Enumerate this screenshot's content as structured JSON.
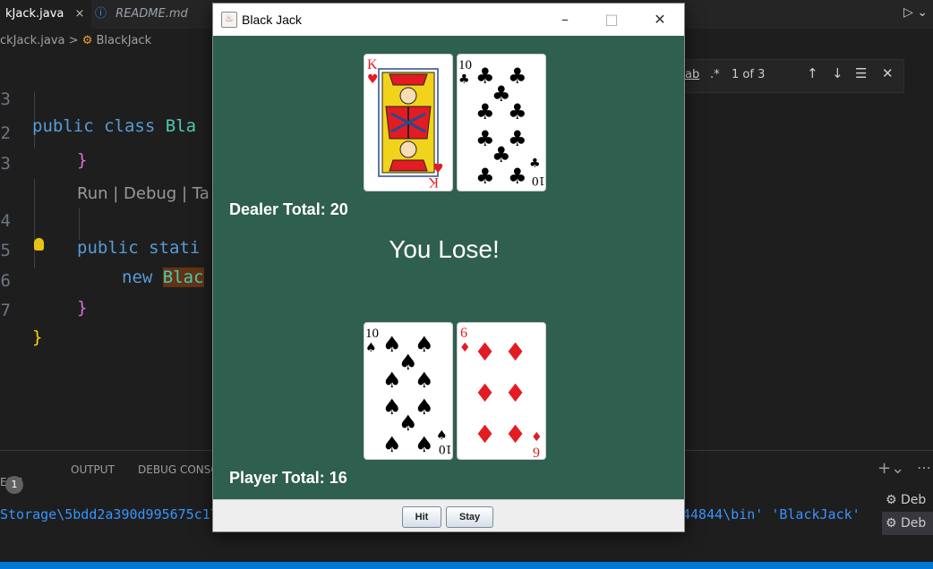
{
  "vscode": {
    "tabs": [
      {
        "label": "kJack.java",
        "close": "×"
      },
      {
        "label": "README.md",
        "icon": "info-icon"
      }
    ],
    "breadcrumb": {
      "file": "ckJack.java",
      "separator": ">",
      "symbol": "BlackJack"
    },
    "code": {
      "line_numbers": [
        "3",
        "2",
        "3",
        "4",
        "5",
        "6",
        "7"
      ],
      "l1_kw": "public class ",
      "l1_cls": "Bla",
      "l2": "}",
      "codelens": "Run | Debug | Ta",
      "l4_kw": "public stati",
      "l5_kw": "new ",
      "l5_cls": "Blac",
      "l6": "}",
      "l7": "}"
    },
    "find": {
      "ab": "ab",
      "regex": ".*",
      "count": "1 of 3"
    },
    "panel": {
      "problems": "EMS",
      "problems_count": "1",
      "output": "OUTPUT",
      "debug_console": "DEBUG CONSO",
      "terminal_left": "Storage\\5bdd2a390d995675c17",
      "terminal_right": "44844\\bin' 'BlackJack'",
      "debug_items": [
        "Deb",
        "Deb"
      ]
    }
  },
  "window": {
    "title": "Black Jack",
    "minimize": "–",
    "maximize": "□",
    "close": "✕"
  },
  "game": {
    "dealer_total": "Dealer Total: 20",
    "player_total": "Player Total: 16",
    "result": "You Lose!",
    "dealer_cards": [
      {
        "rank": "K",
        "suit": "♥",
        "color": "#e31b23"
      },
      {
        "rank": "10",
        "suit": "♣",
        "color": "#000000"
      }
    ],
    "player_cards": [
      {
        "rank": "10",
        "suit": "♠",
        "color": "#000000"
      },
      {
        "rank": "6",
        "suit": "♦",
        "color": "#e31b23"
      }
    ],
    "buttons": {
      "hit": "Hit",
      "stay": "Stay"
    }
  }
}
